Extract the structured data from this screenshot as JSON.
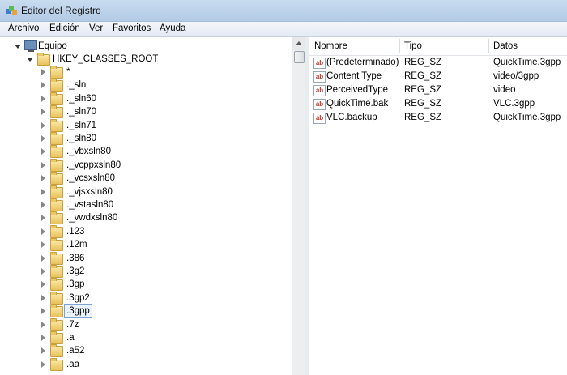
{
  "window": {
    "title": "Editor del Registro",
    "icon": "registry-editor-icon"
  },
  "menu": [
    "Archivo",
    "Edición",
    "Ver",
    "Favoritos",
    "Ayuda"
  ],
  "tree": {
    "root": "Equipo",
    "hive": "HKEY_CLASSES_ROOT",
    "items": [
      "*",
      "._sln",
      "._sln60",
      "._sln70",
      "._sln71",
      "._sln80",
      "._vbxsln80",
      "._vcppxsln80",
      "._vcsxsln80",
      "._vjsxsln80",
      "._vstasln80",
      "._vwdxsln80",
      ".123",
      ".12m",
      ".386",
      ".3g2",
      ".3gp",
      ".3gp2",
      ".3gpp",
      ".7z",
      ".a",
      ".a52",
      ".aa"
    ],
    "selected": ".3gpp"
  },
  "list": {
    "columns": [
      "Nombre",
      "Tipo",
      "Datos"
    ],
    "rows": [
      [
        "(Predeterminado)",
        "REG_SZ",
        "QuickTime.3gpp"
      ],
      [
        "Content Type",
        "REG_SZ",
        "video/3gpp"
      ],
      [
        "PerceivedType",
        "REG_SZ",
        "video"
      ],
      [
        "QuickTime.bak",
        "REG_SZ",
        "VLC.3gpp"
      ],
      [
        "VLC.backup",
        "REG_SZ",
        "QuickTime.3gpp"
      ]
    ]
  },
  "colors": {
    "titlebar": "#b9d1ea",
    "selection_outline": "#7da2ce",
    "folder": "#e7c15c"
  }
}
